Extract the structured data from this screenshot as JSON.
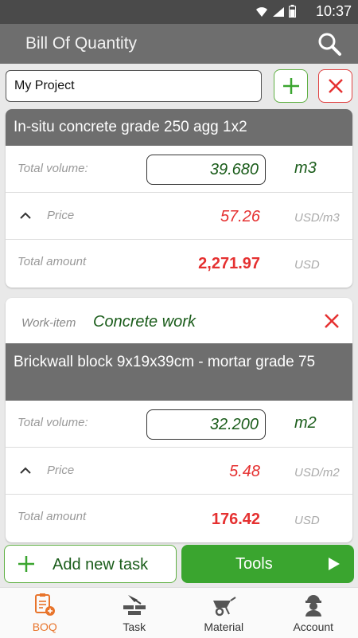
{
  "status": {
    "time": "10:37"
  },
  "appbar": {
    "title": "Bill Of Quantity"
  },
  "project": {
    "value": "My Project"
  },
  "colors": {
    "accent_green": "#3aa52f",
    "dark_green": "#1a5c1a",
    "red": "#e53030",
    "header_gray": "#6e6e6e",
    "nav_active": "#e8742b"
  },
  "card1": {
    "title": "In-situ concrete grade 250 agg 1x2",
    "volume_label": "Total volume:",
    "volume": "39.680",
    "volume_unit": "m3",
    "price_label": "Price",
    "price": "57.26",
    "price_unit": "USD/m3",
    "amount_label": "Total amount",
    "amount": "2,271.97",
    "amount_unit": "USD"
  },
  "card2": {
    "workitem_label": "Work-item",
    "workitem_value": "Concrete work",
    "title": "Brickwall block 9x19x39cm - mortar grade 75",
    "volume_label": "Total volume:",
    "volume": "32.200",
    "volume_unit": "m2",
    "price_label": "Price",
    "price": "5.48",
    "price_unit": "USD/m2",
    "amount_label": "Total amount",
    "amount": "176.42",
    "amount_unit": "USD"
  },
  "actions": {
    "add_task": "Add new task",
    "tools": "Tools"
  },
  "nav": {
    "boq": "BOQ",
    "task": "Task",
    "material": "Material",
    "account": "Account"
  }
}
